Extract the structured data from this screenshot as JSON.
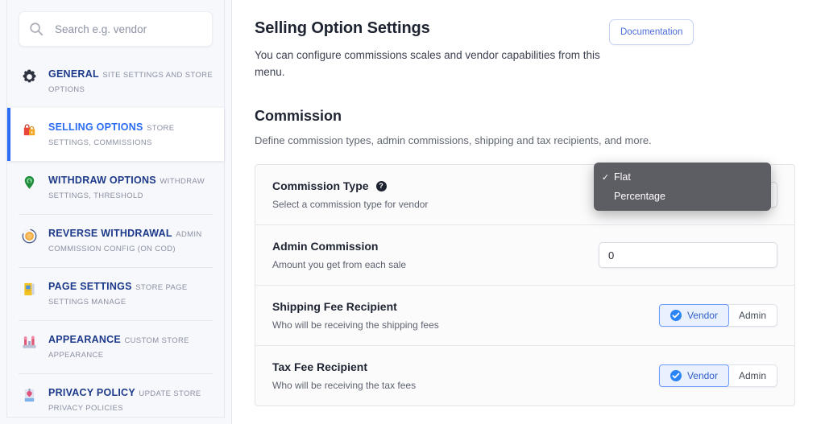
{
  "sidebar": {
    "search": {
      "placeholder": "Search e.g. vendor",
      "value": "",
      "icon": "search-icon"
    },
    "items": [
      {
        "title": "GENERAL",
        "sub": "SITE SETTINGS AND STORE OPTIONS",
        "icon": "gear-icon",
        "active": false
      },
      {
        "title": "SELLING OPTIONS",
        "sub": "STORE SETTINGS, COMMISSIONS",
        "icon": "shopping-bags-icon",
        "active": true
      },
      {
        "title": "WITHDRAW OPTIONS",
        "sub": "WITHDRAW SETTINGS, THRESHOLD",
        "icon": "money-pin-icon",
        "active": false
      },
      {
        "title": "REVERSE WITHDRAWAL",
        "sub": "ADMIN COMMISSION CONFIG (ON COD)",
        "icon": "coin-refresh-icon",
        "active": false
      },
      {
        "title": "PAGE SETTINGS",
        "sub": "STORE PAGE SETTINGS MANAGE",
        "icon": "page-book-icon",
        "active": false
      },
      {
        "title": "APPEARANCE",
        "sub": "CUSTOM STORE APPEARANCE",
        "icon": "storefront-icon",
        "active": false
      },
      {
        "title": "PRIVACY POLICY",
        "sub": "UPDATE STORE PRIVACY POLICIES",
        "icon": "document-icon",
        "active": false
      }
    ]
  },
  "header": {
    "title": "Selling Option Settings",
    "description": "You can configure commissions scales and vendor capabilities from this menu.",
    "documentation_label": "Documentation"
  },
  "commission": {
    "title": "Commission",
    "description": "Define commission types, admin commissions, shipping and tax recipients, and more.",
    "rows": [
      {
        "title": "Commission Type",
        "sub": "Select a commission type for vendor",
        "help": "?",
        "control": "select"
      },
      {
        "title": "Admin Commission",
        "sub": "Amount you get from each sale",
        "control": "input",
        "value": "0"
      },
      {
        "title": "Shipping Fee Recipient",
        "sub": "Who will be receiving the shipping fees",
        "control": "segmented"
      },
      {
        "title": "Tax Fee Recipient",
        "sub": "Who will be receiving the tax fees",
        "control": "segmented"
      }
    ],
    "dropdown": {
      "open": true,
      "options": [
        {
          "label": "Flat",
          "checked": true
        },
        {
          "label": "Percentage",
          "checked": false
        }
      ],
      "check_glyph": "✓"
    },
    "segmented": {
      "options": [
        {
          "label": "Vendor",
          "selected": true
        },
        {
          "label": "Admin",
          "selected": false
        }
      ]
    }
  },
  "colors": {
    "accent_blue": "#2b6cf5",
    "nav_title_blue": "#1d3a8a",
    "sidebar_bg": "#f7f8fb",
    "dropdown_bg": "#5d5d64",
    "segment_selected_bg": "#eaf1fe",
    "segment_selected_border": "#6f9bfa",
    "check_circle_blue": "#2b84f5",
    "doc_border": "#c6d3f7"
  }
}
